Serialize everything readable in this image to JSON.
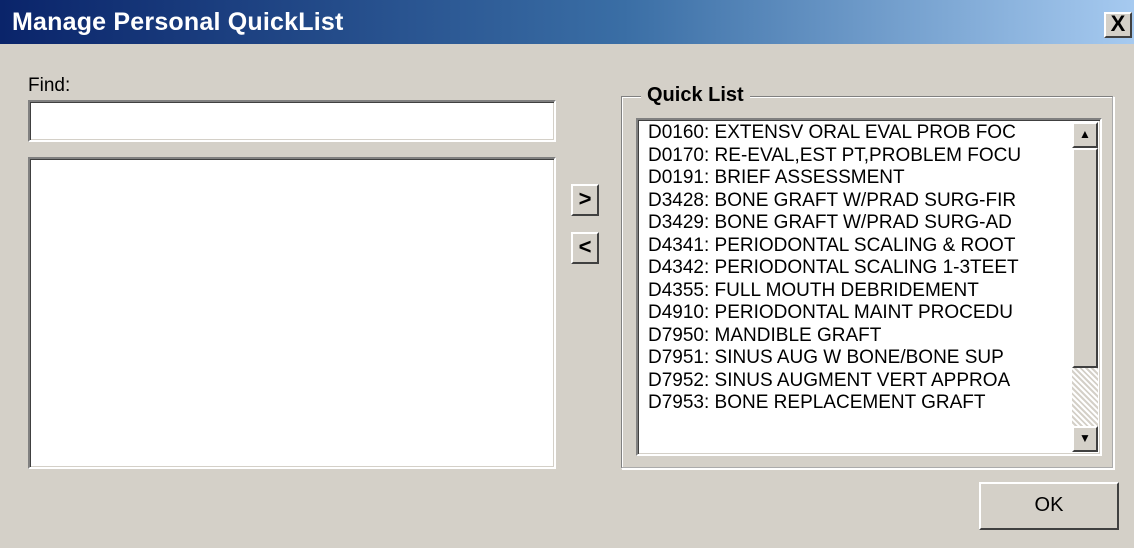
{
  "window": {
    "title": "Manage Personal QuickList",
    "close_glyph": "X"
  },
  "find": {
    "label": "Find:",
    "value": "",
    "placeholder": ""
  },
  "transfer": {
    "add_glyph": ">",
    "remove_glyph": "<"
  },
  "quick_list": {
    "title": "Quick List",
    "items": [
      "D0160:  EXTENSV ORAL EVAL PROB FOC",
      "D0170:  RE-EVAL,EST PT,PROBLEM FOCU",
      "D0191:  BRIEF ASSESSMENT",
      "D3428:  BONE GRAFT W/PRAD SURG-FIR",
      "D3429:  BONE GRAFT W/PRAD SURG-AD",
      "D4341:  PERIODONTAL SCALING & ROOT",
      "D4342:  PERIODONTAL SCALING 1-3TEET",
      "D4355:  FULL MOUTH DEBRIDEMENT",
      "D4910:  PERIODONTAL MAINT PROCEDU",
      "D7950:  MANDIBLE GRAFT",
      "D7951:  SINUS AUG W BONE/BONE SUP",
      "D7952:  SINUS AUGMENT VERT APPROA",
      "D7953:  BONE REPLACEMENT GRAFT"
    ],
    "scroll_up_glyph": "▲",
    "scroll_down_glyph": "▼"
  },
  "buttons": {
    "ok_label": "OK"
  }
}
